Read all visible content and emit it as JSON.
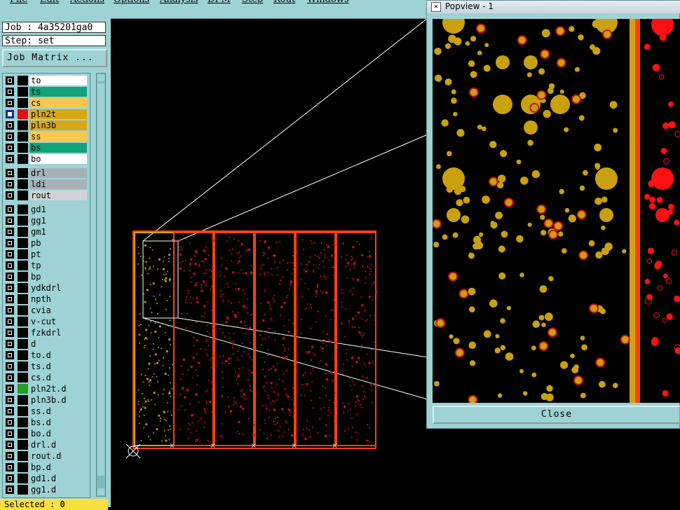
{
  "menu": [
    "File",
    "Edit",
    "Actions",
    "Options",
    "Analysis",
    "DFM",
    "Step",
    "Rout",
    "Windows"
  ],
  "job": {
    "label": "Job : 4a35201ga0",
    "step": "Step: set",
    "matrix_button": "Job Matrix ..."
  },
  "layers": {
    "group1": [
      {
        "name": "to",
        "color": "#ffffff",
        "checked": false,
        "swatch": "#000000"
      },
      {
        "name": "ts",
        "color": "#12a27a",
        "checked": false,
        "swatch": "#000000"
      },
      {
        "name": "cs",
        "color": "#f8c850",
        "checked": false,
        "swatch": "#000000"
      },
      {
        "name": "pln2t",
        "color": "#d8a818",
        "checked": true,
        "swatch": "#e01010"
      },
      {
        "name": "pln3b",
        "color": "#d8a818",
        "checked": false,
        "swatch": "#000000"
      },
      {
        "name": "ss",
        "color": "#f8c850",
        "checked": false,
        "swatch": "#000000"
      },
      {
        "name": "bs",
        "color": "#12a27a",
        "checked": false,
        "swatch": "#000000"
      },
      {
        "name": "bo",
        "color": "#ffffff",
        "checked": false,
        "swatch": "#000000"
      }
    ],
    "group2": [
      {
        "name": "drl",
        "color": "#a6b2b8",
        "checked": false,
        "swatch": "#000000"
      },
      {
        "name": "ldi",
        "color": "#a6b2b8",
        "checked": false,
        "swatch": "#000000"
      },
      {
        "name": "rout",
        "color": "#d0d4d4",
        "checked": false,
        "swatch": "#000000"
      }
    ],
    "group3": [
      {
        "name": "gd1",
        "color": "#9ed2d4",
        "checked": false,
        "swatch": "#000000"
      },
      {
        "name": "gg1",
        "color": "#9ed2d4",
        "checked": false,
        "swatch": "#000000"
      },
      {
        "name": "gm1",
        "color": "#9ed2d4",
        "checked": false,
        "swatch": "#000000"
      },
      {
        "name": "pb",
        "color": "#9ed2d4",
        "checked": false,
        "swatch": "#000000"
      },
      {
        "name": "pt",
        "color": "#9ed2d4",
        "checked": false,
        "swatch": "#000000"
      },
      {
        "name": "tp",
        "color": "#9ed2d4",
        "checked": false,
        "swatch": "#000000"
      },
      {
        "name": "bp",
        "color": "#9ed2d4",
        "checked": false,
        "swatch": "#000000"
      },
      {
        "name": "ydkdrl",
        "color": "#9ed2d4",
        "checked": false,
        "swatch": "#000000"
      },
      {
        "name": "npth",
        "color": "#9ed2d4",
        "checked": false,
        "swatch": "#000000"
      },
      {
        "name": "cvia",
        "color": "#9ed2d4",
        "checked": false,
        "swatch": "#000000"
      },
      {
        "name": "v-cut",
        "color": "#9ed2d4",
        "checked": false,
        "swatch": "#000000"
      },
      {
        "name": "fzkdrl",
        "color": "#9ed2d4",
        "checked": false,
        "swatch": "#000000"
      },
      {
        "name": "d",
        "color": "#9ed2d4",
        "checked": false,
        "swatch": "#000000"
      },
      {
        "name": "to.d",
        "color": "#9ed2d4",
        "checked": false,
        "swatch": "#000000"
      },
      {
        "name": "ts.d",
        "color": "#9ed2d4",
        "checked": false,
        "swatch": "#000000"
      },
      {
        "name": "cs.d",
        "color": "#9ed2d4",
        "checked": false,
        "swatch": "#000000"
      },
      {
        "name": "pln2t.d",
        "color": "#9ed2d4",
        "checked": false,
        "swatch": "#22a022"
      },
      {
        "name": "pln3b.d",
        "color": "#9ed2d4",
        "checked": false,
        "swatch": "#000000"
      },
      {
        "name": "ss.d",
        "color": "#9ed2d4",
        "checked": false,
        "swatch": "#000000"
      },
      {
        "name": "bs.d",
        "color": "#9ed2d4",
        "checked": false,
        "swatch": "#000000"
      },
      {
        "name": "bo.d",
        "color": "#9ed2d4",
        "checked": false,
        "swatch": "#000000"
      },
      {
        "name": "drl.d",
        "color": "#9ed2d4",
        "checked": false,
        "swatch": "#000000"
      },
      {
        "name": "rout.d",
        "color": "#9ed2d4",
        "checked": false,
        "swatch": "#000000"
      },
      {
        "name": "bp.d",
        "color": "#9ed2d4",
        "checked": false,
        "swatch": "#000000"
      },
      {
        "name": "gd1.d",
        "color": "#9ed2d4",
        "checked": false,
        "swatch": "#000000"
      },
      {
        "name": "gg1.d",
        "color": "#9ed2d4",
        "checked": false,
        "swatch": "#000000"
      }
    ]
  },
  "status": "Selected : 0",
  "popup": {
    "title": "Popview - 1",
    "icon": "app-icon",
    "close_label": "Close"
  },
  "colors": {
    "panel": "#9ed2d4",
    "copper": "#d4a017",
    "pad_red": "#e81010",
    "outline": "#ff4010"
  }
}
